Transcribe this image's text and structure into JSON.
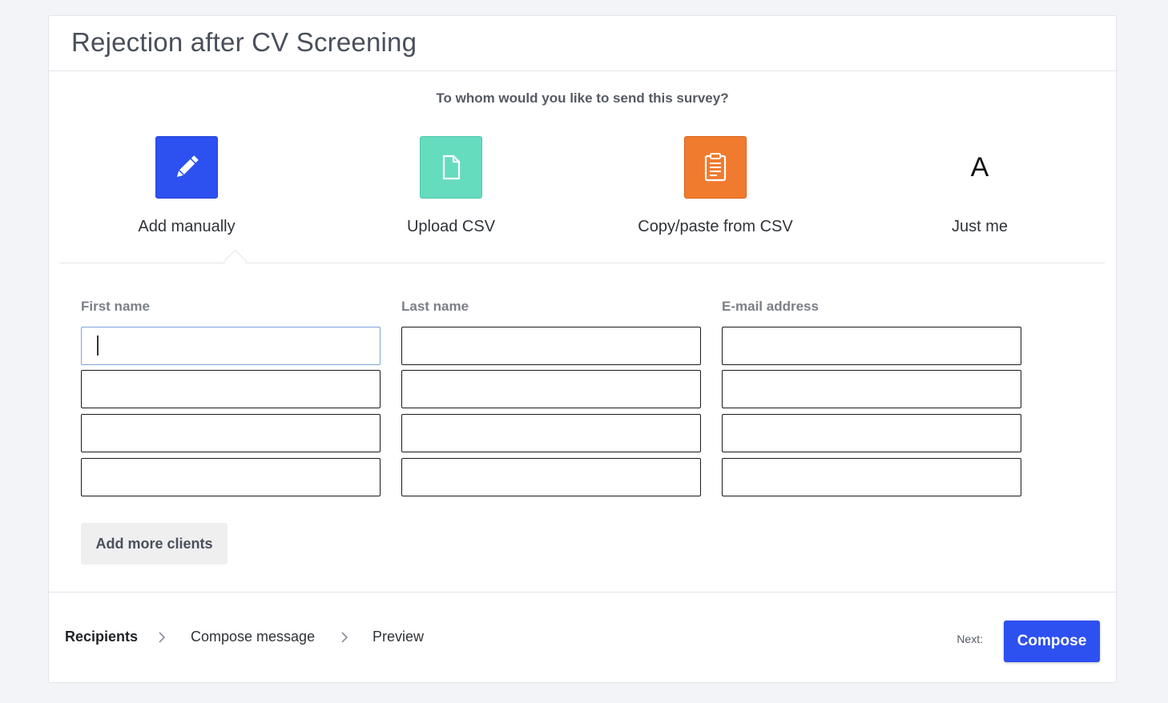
{
  "header": {
    "title": "Rejection after CV Screening"
  },
  "recipients": {
    "question": "To whom would you like to send this survey?",
    "options": [
      {
        "label": "Add manually",
        "icon": "pencil-icon",
        "color": "#2d50f0",
        "selected": true
      },
      {
        "label": "Upload CSV",
        "icon": "file-icon",
        "color": "#66dcbf",
        "selected": false
      },
      {
        "label": "Copy/paste from CSV",
        "icon": "clipboard-icon",
        "color": "#f07b2f",
        "selected": false
      },
      {
        "label": "Just me",
        "icon": "letter-a-icon",
        "icon_text": "A",
        "selected": false
      }
    ]
  },
  "form": {
    "columns": [
      "First name",
      "Last name",
      "E-mail address"
    ],
    "rows": [
      [
        "",
        "",
        ""
      ],
      [
        "",
        "",
        ""
      ],
      [
        "",
        "",
        ""
      ],
      [
        "",
        "",
        ""
      ]
    ],
    "add_more_label": "Add more clients"
  },
  "footer": {
    "steps": [
      "Recipients",
      "Compose message",
      "Preview"
    ],
    "active_step": "Recipients",
    "next_label": "Next:",
    "compose_label": "Compose"
  },
  "colors": {
    "primary": "#2d50f0",
    "upload": "#66dcbf",
    "copy_paste": "#f07b2f",
    "background": "#f3f4f7"
  }
}
